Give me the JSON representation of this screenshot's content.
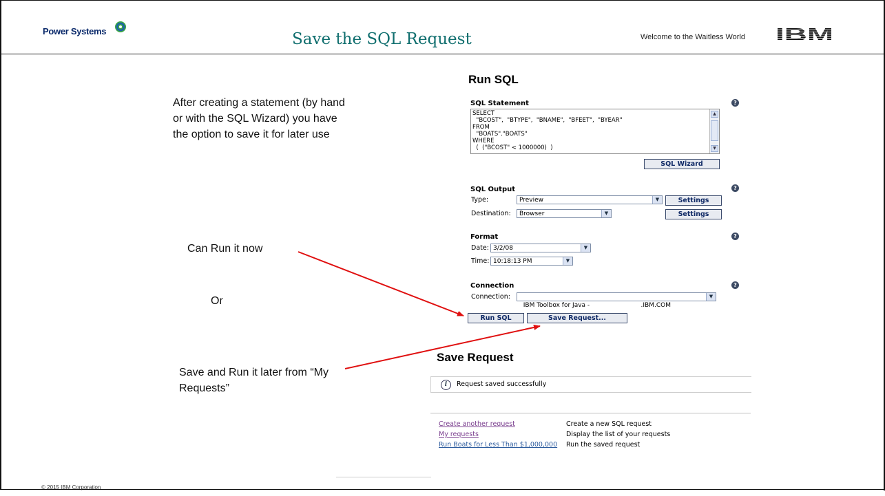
{
  "header": {
    "brand": "Power Systems",
    "title": "Save the SQL Request",
    "welcome": "Welcome to the Waitless World",
    "ibm_logo": "IBM"
  },
  "notes": {
    "note1": "After creating a statement (by hand or with the SQL Wizard) you have the option to save it for later use",
    "note2": "Can Run it now",
    "note3": "Or",
    "note4": "Save and Run it later from “My Requests”"
  },
  "run_sql": {
    "heading": "Run SQL",
    "sql_statement_label": "SQL Statement",
    "sql_text": "SELECT\n  \"BCOST\",  \"BTYPE\",  \"BNAME\",  \"BFEET\",  \"BYEAR\"\nFROM\n  \"BOATS\".\"BOATS\"\nWHERE\n  (  (\"BCOST\" < 1000000)  )",
    "sql_wizard_button": "SQL Wizard",
    "output_label": "SQL Output",
    "type_label": "Type:",
    "type_value": "Preview",
    "destination_label": "Destination:",
    "destination_value": "Browser",
    "settings_button": "Settings",
    "format_label": "Format",
    "date_label": "Date:",
    "date_value": "3/2/08",
    "time_label": "Time:",
    "time_value": "10:18:13 PM",
    "connection_label": "Connection",
    "connection_field_label": "Connection:",
    "connection_value": "IBM Toolbox for Java -                          .IBM.COM",
    "run_button": "Run SQL",
    "save_button": "Save Request..."
  },
  "save_request": {
    "heading": "Save Request",
    "message": "Request saved successfully",
    "links": [
      {
        "label": "Create another request",
        "desc": "Create a new SQL request"
      },
      {
        "label": "My requests",
        "desc": "Display the list of your requests"
      },
      {
        "label": "Run Boats for Less Than $1,000,000",
        "desc": "Run the saved request"
      }
    ]
  },
  "footer": {
    "copyright": "© 2015 IBM Corporation"
  },
  "colors": {
    "title_teal": "#0f6e6e",
    "arrow_red": "#e01010",
    "button_text": "#102a66",
    "visited_link": "#7b3f8f"
  }
}
